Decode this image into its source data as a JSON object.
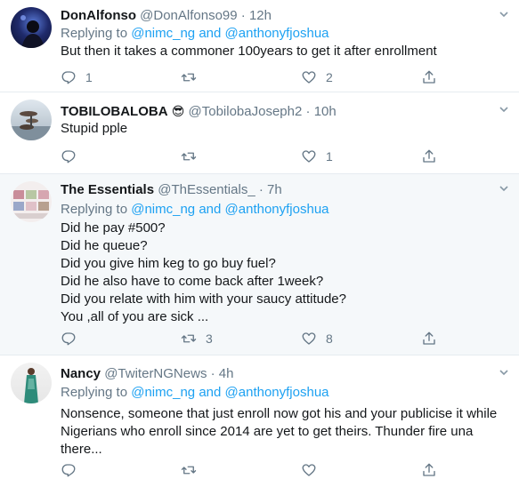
{
  "tweets": [
    {
      "name": "DonAlfonso",
      "handle": "@DonAlfonso99",
      "dot": "·",
      "time": "12h",
      "replying_prefix": "Replying to",
      "mention1": "@nimc_ng",
      "and": "and",
      "mention2": "@anthonyfjoshua",
      "lines": [
        "But then it takes a commoner 100years to get it after enrollment"
      ],
      "replies": "1",
      "retweets": "",
      "likes": "2"
    },
    {
      "name": "TOBILOBALOBA",
      "emoji": "😎",
      "handle": "@TobilobaJoseph2",
      "dot": "·",
      "time": "10h",
      "lines": [
        "Stupid pple"
      ],
      "replies": "",
      "retweets": "",
      "likes": "1"
    },
    {
      "name": "The Essentials",
      "handle": "@ThEssentials_",
      "dot": "·",
      "time": "7h",
      "replying_prefix": "Replying to",
      "mention1": "@nimc_ng",
      "and": "and",
      "mention2": "@anthonyfjoshua",
      "lines": [
        "Did he pay #500?",
        "Did he queue?",
        "Did you give him keg to go buy fuel?",
        "Did he also have to come back after 1week?",
        "Did you relate with him with your saucy attitude?",
        "You ,all of you are sick ..."
      ],
      "replies": "",
      "retweets": "3",
      "likes": "8"
    },
    {
      "name": "Nancy",
      "handle": "@TwiterNGNews",
      "dot": "·",
      "time": "4h",
      "replying_prefix": "Replying to",
      "mention1": "@nimc_ng",
      "and": "and",
      "mention2": "@anthonyfjoshua",
      "lines": [
        "Nonsence, someone that just enroll now got his and your publicise it while",
        "Nigerians who enroll since 2014 are yet to get theirs. Thunder fire una",
        "there..."
      ],
      "replies": "",
      "retweets": "",
      "likes": ""
    }
  ],
  "icons": {
    "reply": "reply-icon",
    "retweet": "retweet-icon",
    "like": "heart-icon",
    "share": "share-icon",
    "caret": "chevron-down-icon"
  },
  "colors": {
    "link": "#1da1f2",
    "muted": "#657786",
    "highlight_bg": "#f5f8fa"
  }
}
